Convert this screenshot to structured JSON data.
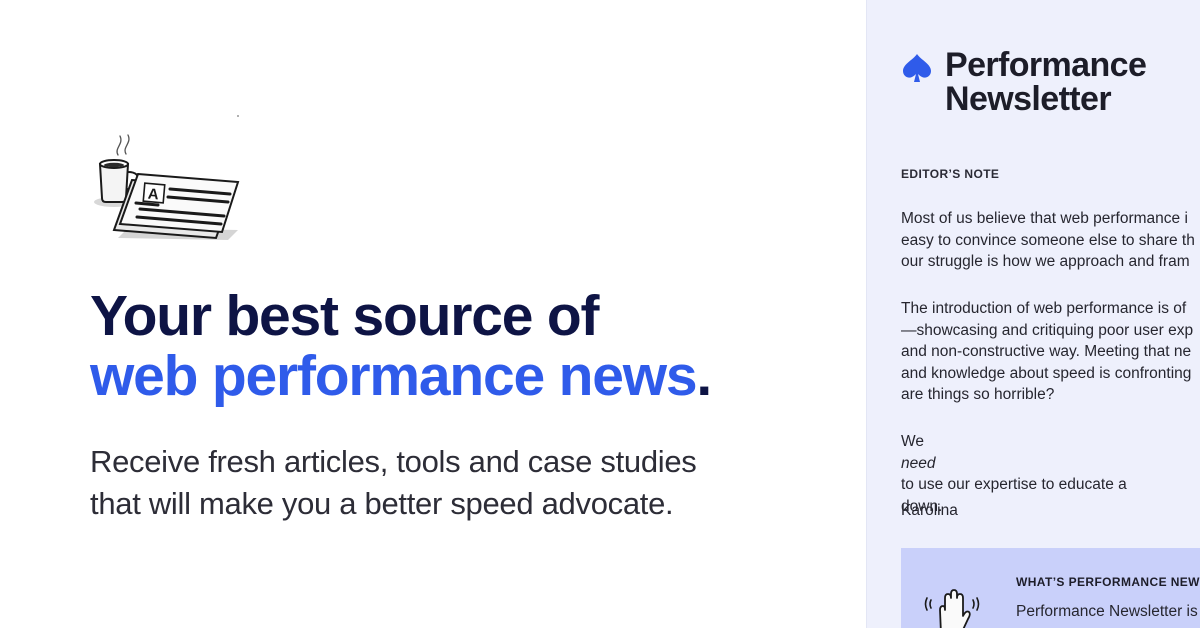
{
  "hero": {
    "headline_line1": "Your best source of",
    "headline_accent": "web performance news",
    "headline_period": ".",
    "lede_line1": "Receive fresh articles, tools and case studies",
    "lede_line2": "that will make you a better speed advocate.",
    "illustration_icon": "newspaper-and-coffee-icon",
    "illustration_letter": "A"
  },
  "newsletter": {
    "brand_line1": "Performance",
    "brand_line2": "Newsletter",
    "brand_icon": "spade-icon",
    "editor_label": "EDITOR’S NOTE",
    "p1": [
      "Most of us believe that web performance i",
      "easy to convince someone else to share th",
      "our struggle is how we approach and fram"
    ],
    "p2": [
      "The introduction of web performance is of",
      "—showcasing and critiquing poor user exp",
      "and non-constructive way. Meeting that ne",
      "and knowledge about speed is confronting",
      "are things so horrible?"
    ],
    "p3_pre": "We ",
    "p3_emph": "need",
    "p3_post": " to use our expertise to educate a",
    "p3_line2": "down.",
    "signature": "Karolina",
    "card": {
      "icon": "waving-hand-icon",
      "title": "WHAT’S PERFORMANCE NEWS",
      "text": "Performance Newsletter is a"
    }
  },
  "colors": {
    "accent": "#2f5bea",
    "navy": "#0e1445",
    "panel": "#eef0fc",
    "card": "#c9d0fa"
  }
}
